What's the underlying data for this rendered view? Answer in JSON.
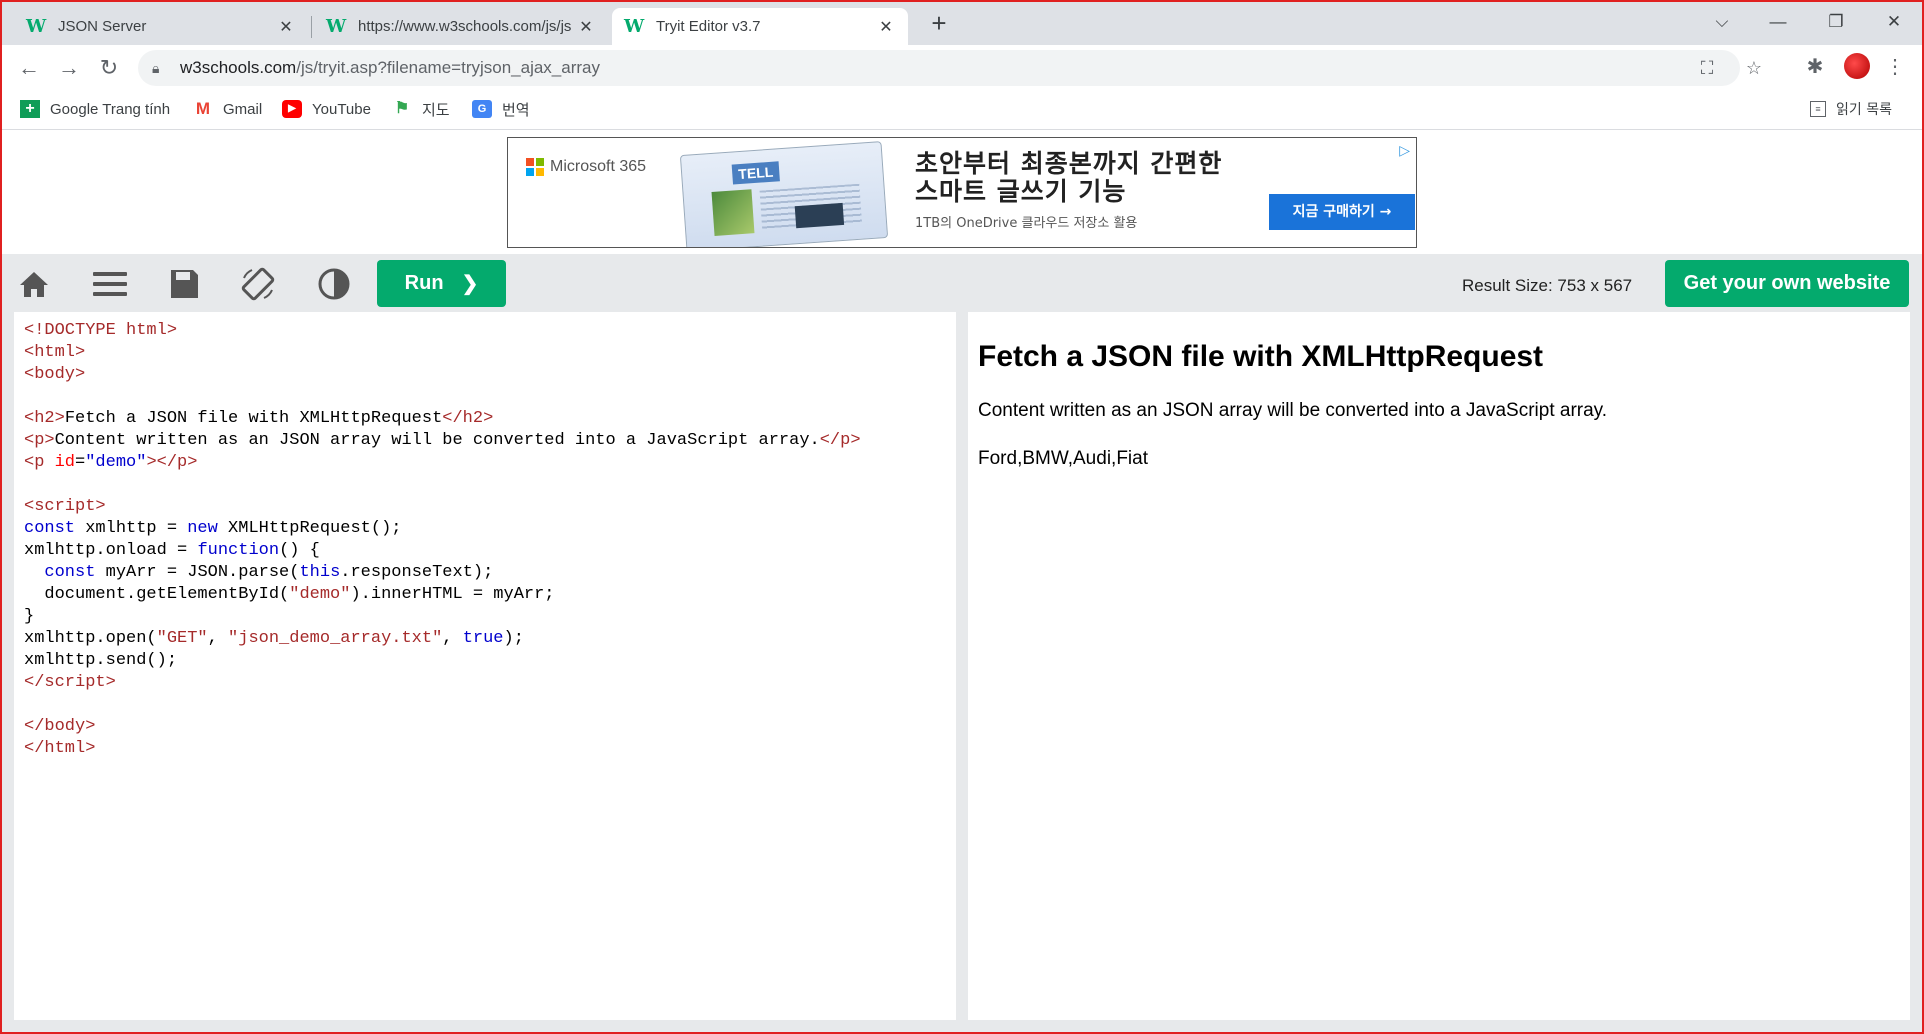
{
  "browser": {
    "tabs": [
      {
        "title": "JSON Server",
        "active": false
      },
      {
        "title": "https://www.w3schools.com/js/js",
        "active": false
      },
      {
        "title": "Tryit Editor v3.7",
        "active": true
      }
    ],
    "favicon_letter": "W",
    "url_host": "w3schools.com",
    "url_path": "/js/tryit.asp?filename=tryjson_ajax_array",
    "bookmarks": [
      {
        "label": "Google Trang tính",
        "icon": "sheets-icon"
      },
      {
        "label": "Gmail",
        "icon": "gmail-icon"
      },
      {
        "label": "YouTube",
        "icon": "youtube-icon"
      },
      {
        "label": "지도",
        "icon": "maps-icon"
      },
      {
        "label": "번역",
        "icon": "translate-icon"
      }
    ],
    "reading_list": "읽기 목록"
  },
  "ad": {
    "brand": "Microsoft 365",
    "doc_label": "TELL",
    "headline_1": "초안부터 최종본까지 간편한",
    "headline_2": "스마트 글쓰기 기능",
    "subline": "1TB의 OneDrive 클라우드 저장소 활용",
    "cta": "지금 구매하기 →"
  },
  "tryit": {
    "run_label": "Run",
    "result_size": "Result Size: 753 x 567",
    "get_website": "Get your own website"
  },
  "result": {
    "heading": "Fetch a JSON file with XMLHttpRequest",
    "paragraph": "Content written as an JSON array will be converted into a JavaScript array.",
    "output": "Ford,BMW,Audi,Fiat"
  },
  "colors": {
    "accent_green": "#04aa6d",
    "toolbar_gray": "#e7e9eb"
  }
}
